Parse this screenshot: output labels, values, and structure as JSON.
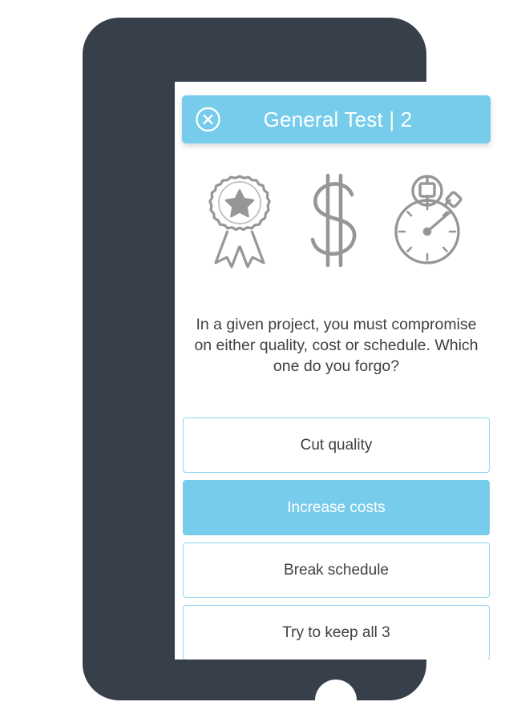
{
  "app": {
    "device": "smartphone-mockup",
    "frame_color": "#373F4A",
    "accent_color": "#77CCEC",
    "border_color": "#8DD6F2",
    "text_color": "#3F4041",
    "icon_color": "#949698"
  },
  "header": {
    "title": "General Test | 2",
    "close_icon": "close-circle-icon"
  },
  "icons": [
    {
      "name": "award-ribbon-icon",
      "meaning": "quality"
    },
    {
      "name": "dollar-sign-icon",
      "meaning": "cost"
    },
    {
      "name": "stopwatch-icon",
      "meaning": "schedule"
    }
  ],
  "question": {
    "text": "In a given project, you must compromise on either quality, cost or schedule. Which one do you forgo?"
  },
  "options": [
    {
      "label": "Cut quality",
      "selected": false
    },
    {
      "label": "Increase costs",
      "selected": true
    },
    {
      "label": "Break schedule",
      "selected": false
    },
    {
      "label": "Try to keep all 3",
      "selected": false
    }
  ],
  "device": {
    "home_button": "home-button"
  }
}
